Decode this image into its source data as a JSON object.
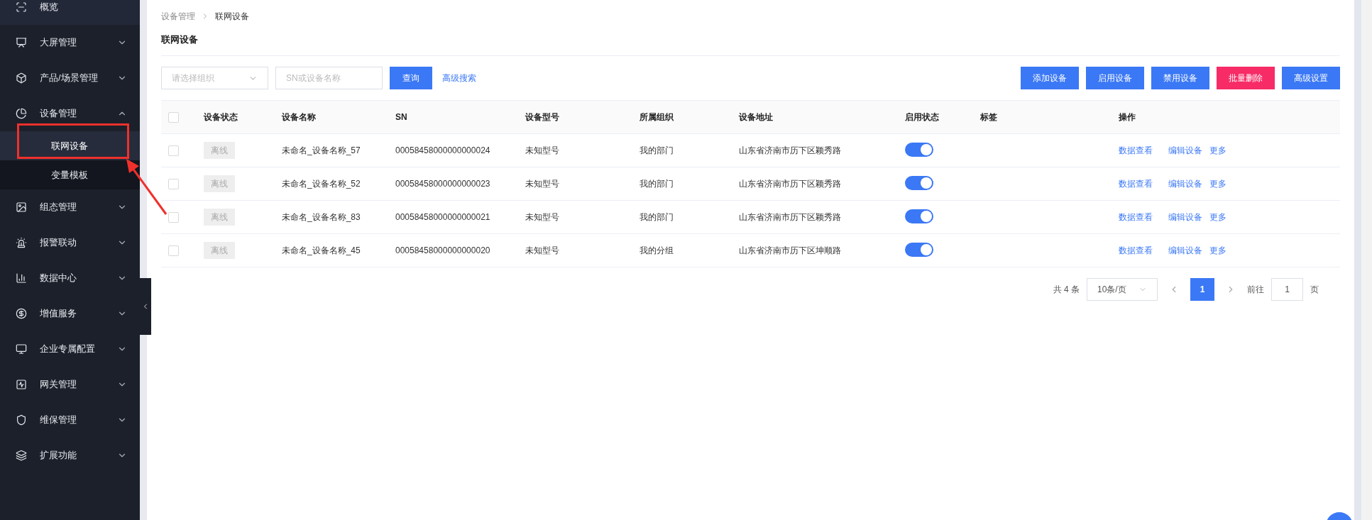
{
  "sidebar": {
    "items": [
      {
        "label": "概览",
        "selected": false
      },
      {
        "label": "大屏管理",
        "selected": false,
        "expanded": false
      },
      {
        "label": "产品/场景管理",
        "selected": false,
        "expanded": false
      },
      {
        "label": "设备管理",
        "selected": false,
        "expanded": true,
        "children": [
          {
            "label": "联网设备",
            "selected": true
          },
          {
            "label": "变量模板",
            "selected": false
          }
        ]
      },
      {
        "label": "组态管理",
        "selected": false,
        "expanded": false
      },
      {
        "label": "报警联动",
        "selected": false,
        "expanded": false
      },
      {
        "label": "数据中心",
        "selected": false,
        "expanded": false
      },
      {
        "label": "增值服务",
        "selected": false,
        "expanded": false
      },
      {
        "label": "企业专属配置",
        "selected": false,
        "expanded": false
      },
      {
        "label": "网关管理",
        "selected": false,
        "expanded": false
      },
      {
        "label": "维保管理",
        "selected": false,
        "expanded": false
      },
      {
        "label": "扩展功能",
        "selected": false,
        "expanded": false
      }
    ]
  },
  "breadcrumb": [
    "设备管理",
    "联网设备"
  ],
  "title": "联网设备",
  "filters": {
    "org_select": {
      "placeholder": "请选择组织"
    },
    "search": {
      "placeholder": "SN或设备名称"
    },
    "query_button": "查询",
    "advanced_search": "高级搜索"
  },
  "actions": [
    {
      "label": "添加设备",
      "kind": "primary"
    },
    {
      "label": "启用设备",
      "kind": "primary"
    },
    {
      "label": "禁用设备",
      "kind": "primary"
    },
    {
      "label": "批量删除",
      "kind": "danger"
    },
    {
      "label": "高级设置",
      "kind": "primary"
    }
  ],
  "table": {
    "select_all": {
      "checked": false
    },
    "columns": [
      "设备状态",
      "设备名称",
      "SN",
      "设备型号",
      "所属组织",
      "设备地址",
      "启用状态",
      "标签",
      "操作"
    ],
    "rows": [
      {
        "checked": false,
        "status": "离线",
        "name": "未命名_设备名称_57",
        "sn": "00058458000000000024",
        "model": "未知型号",
        "org": "我的部门",
        "address": "山东省济南市历下区颖秀路",
        "on": true,
        "ops": [
          "数据查看",
          "编辑设备",
          "更多"
        ]
      },
      {
        "checked": false,
        "status": "离线",
        "name": "未命名_设备名称_52",
        "sn": "00058458000000000023",
        "model": "未知型号",
        "org": "我的部门",
        "address": "山东省济南市历下区颖秀路",
        "on": true,
        "ops": [
          "数据查看",
          "编辑设备",
          "更多"
        ]
      },
      {
        "checked": false,
        "status": "离线",
        "name": "未命名_设备名称_83",
        "sn": "00058458000000000021",
        "model": "未知型号",
        "org": "我的部门",
        "address": "山东省济南市历下区颖秀路",
        "on": true,
        "ops": [
          "数据查看",
          "编辑设备",
          "更多"
        ]
      },
      {
        "checked": false,
        "status": "离线",
        "name": "未命名_设备名称_45",
        "sn": "00058458000000000020",
        "model": "未知型号",
        "org": "我的分组",
        "address": "山东省济南市历下区坤顺路",
        "on": true,
        "ops": [
          "数据查看",
          "编辑设备",
          "更多"
        ]
      }
    ]
  },
  "pagination": {
    "total": "共 4 条",
    "page_size": "10条/页",
    "pages": [
      {
        "label": "1",
        "selected": true
      }
    ],
    "goto_label": "前往",
    "goto_value": "1",
    "goto_suffix": "页"
  }
}
